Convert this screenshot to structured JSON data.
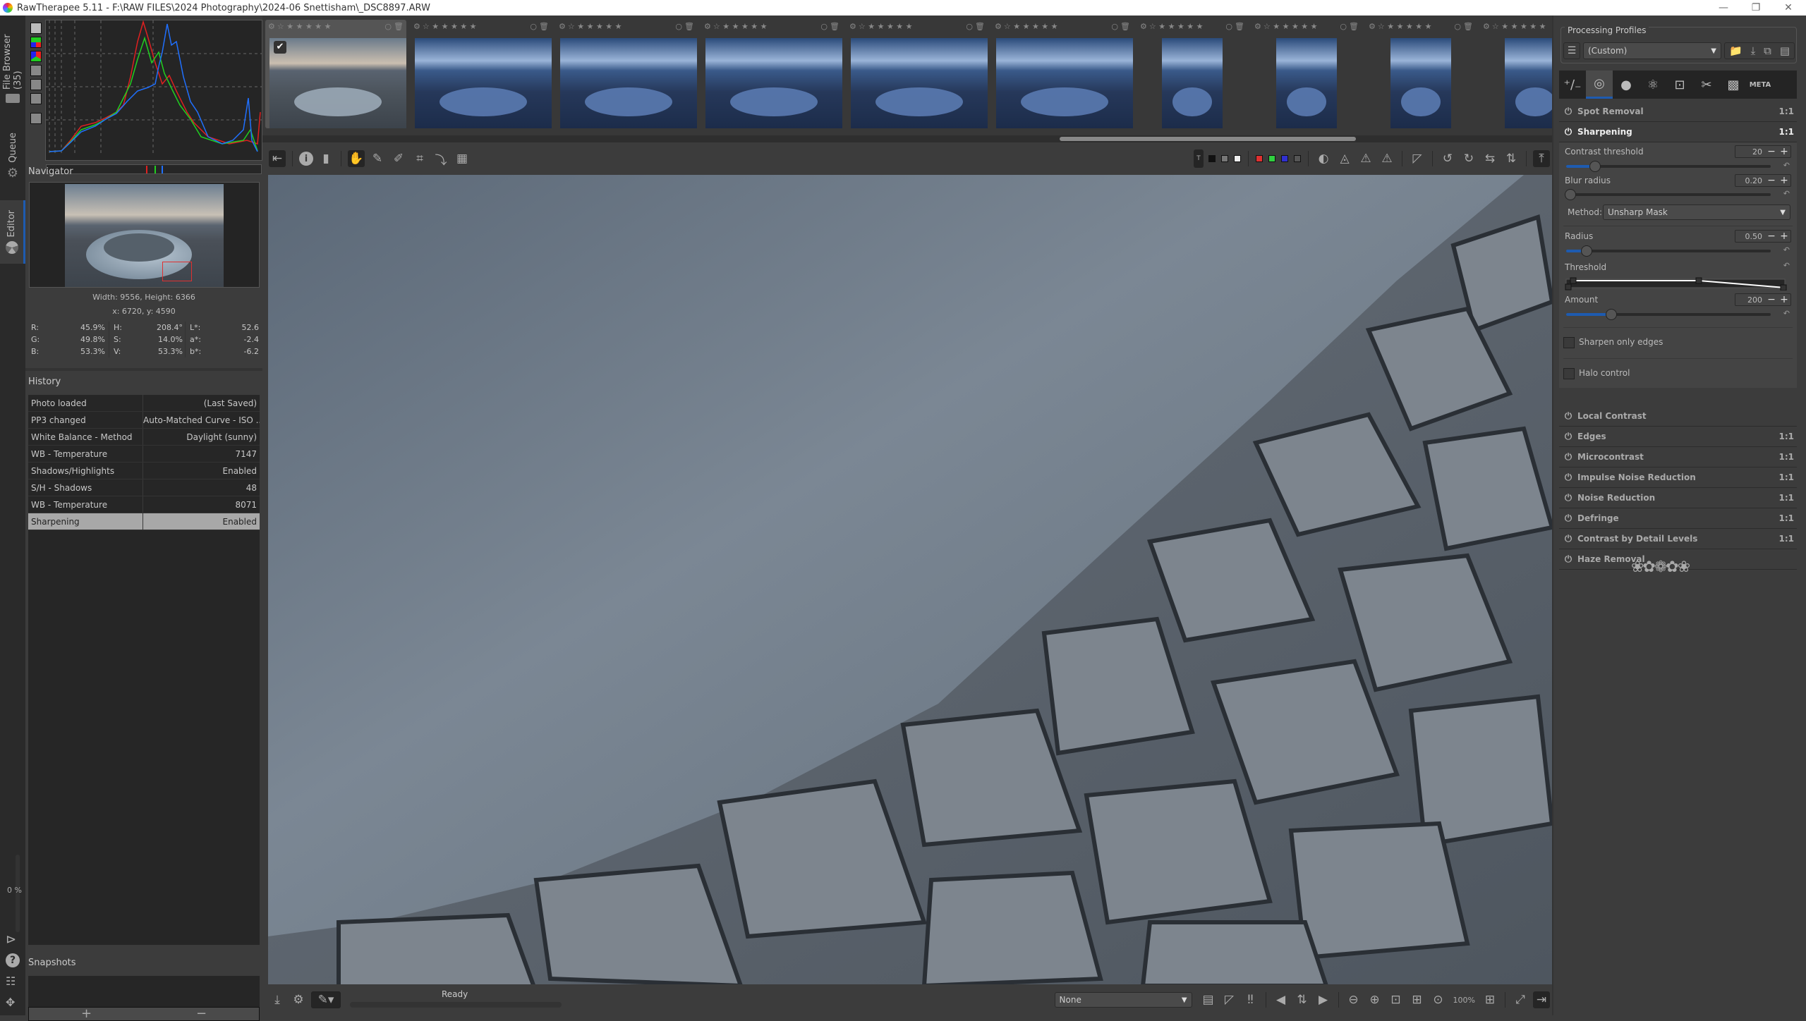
{
  "window": {
    "title": "RawTherapee 5.11 - F:\\RAW FILES\\2024 Photography\\2024-06 Snettisham\\_DSC8897.ARW",
    "minimize": "—",
    "restore": "❐",
    "close": "✕"
  },
  "vertical_tabs": {
    "file_browser": "File Browser (35)",
    "queue": "Queue",
    "editor": "Editor",
    "progress": "0 %"
  },
  "histogram": {
    "tool_icons": [
      "histogram-type-icon",
      "rgb-channels-icon",
      "luminance-icon",
      "waveform-icon",
      "vectorscope-hs-icon",
      "vectorscope-hc-icon",
      "more-icon"
    ],
    "pointer_markers": [
      "#e02020",
      "#20d020",
      "#2070ff"
    ]
  },
  "navigator": {
    "title": "Navigator",
    "dimensions": "Width: 9556, Height: 6366",
    "coords": "x: 6720, y: 4590",
    "rgb": [
      {
        "k": "R:",
        "v": "45.9%"
      },
      {
        "k": "G:",
        "v": "49.8%"
      },
      {
        "k": "B:",
        "v": "53.3%"
      }
    ],
    "hsv": [
      {
        "k": "H:",
        "v": "208.4°"
      },
      {
        "k": "S:",
        "v": "14.0%"
      },
      {
        "k": "V:",
        "v": "53.3%"
      }
    ],
    "lab": [
      {
        "k": "L*:",
        "v": "52.6"
      },
      {
        "k": "a*:",
        "v": "-2.4"
      },
      {
        "k": "b*:",
        "v": "-6.2"
      }
    ]
  },
  "history": {
    "title": "History",
    "rows": [
      {
        "action": "Photo loaded",
        "value": "(Last Saved)"
      },
      {
        "action": "PP3 changed",
        "value": "Auto-Matched Curve - ISO ..."
      },
      {
        "action": "White Balance - Method",
        "value": "Daylight (sunny)"
      },
      {
        "action": "WB - Temperature",
        "value": "7147"
      },
      {
        "action": "Shadows/Highlights",
        "value": "Enabled"
      },
      {
        "action": "S/H - Shadows",
        "value": "48"
      },
      {
        "action": "WB - Temperature",
        "value": "8071"
      },
      {
        "action": "Sharpening",
        "value": "Enabled",
        "selected": true
      }
    ]
  },
  "snapshots": {
    "title": "Snapshots",
    "add": "+",
    "remove": "−"
  },
  "filmstrip": {
    "rating_stars": "☆ ★ ★ ★ ★ ★",
    "thumbs": [
      {
        "tone": "warm",
        "selected": true,
        "orientation": "landscape"
      },
      {
        "tone": "blue",
        "orientation": "landscape"
      },
      {
        "tone": "blue",
        "orientation": "landscape"
      },
      {
        "tone": "blue",
        "orientation": "landscape"
      },
      {
        "tone": "blue",
        "orientation": "landscape"
      },
      {
        "tone": "blue",
        "orientation": "landscape"
      },
      {
        "tone": "blue",
        "orientation": "portrait"
      },
      {
        "tone": "blue",
        "orientation": "portrait"
      },
      {
        "tone": "blue",
        "orientation": "portrait"
      },
      {
        "tone": "blue",
        "orientation": "portrait"
      }
    ]
  },
  "statusbar": {
    "status": "Ready",
    "output_profile": "None",
    "zoom": "100%"
  },
  "processing_profiles": {
    "title": "Processing Profiles",
    "selected": "(Custom)"
  },
  "tool_tabs": [
    "exposure-tab",
    "detail-tab",
    "color-tab",
    "advanced-tab",
    "transform-tab",
    "raw-tab",
    "locallab-tab",
    "meta-tab"
  ],
  "tools": {
    "spot_removal": {
      "label": "Spot Removal",
      "scale": "1:1"
    },
    "sharpening": {
      "label": "Sharpening",
      "scale": "1:1",
      "enabled": true,
      "contrast_threshold": {
        "label": "Contrast threshold",
        "value": "20",
        "fraction": 0.12
      },
      "blur_radius": {
        "label": "Blur radius",
        "value": "0.20",
        "fraction": 0.0
      },
      "method": {
        "label": "Method:",
        "value": "Unsharp Mask"
      },
      "radius": {
        "label": "Radius",
        "value": "0.50",
        "fraction": 0.08
      },
      "threshold": {
        "label": "Threshold"
      },
      "amount": {
        "label": "Amount",
        "value": "200",
        "fraction": 0.2
      },
      "sharpen_only_edges": {
        "label": "Sharpen only edges",
        "checked": false
      },
      "halo_control": {
        "label": "Halo control",
        "checked": false
      }
    },
    "list": [
      {
        "label": "Local Contrast",
        "scale": ""
      },
      {
        "label": "Edges",
        "scale": "1:1"
      },
      {
        "label": "Microcontrast",
        "scale": "1:1"
      },
      {
        "label": "Impulse Noise Reduction",
        "scale": "1:1"
      },
      {
        "label": "Noise Reduction",
        "scale": "1:1"
      },
      {
        "label": "Defringe",
        "scale": "1:1"
      },
      {
        "label": "Contrast by Detail Levels",
        "scale": "1:1"
      },
      {
        "label": "Haze Removal",
        "scale": ""
      }
    ]
  },
  "colors": {
    "accent": "#1e5bb0",
    "panel": "#3c3c3c",
    "dark": "#262626"
  }
}
